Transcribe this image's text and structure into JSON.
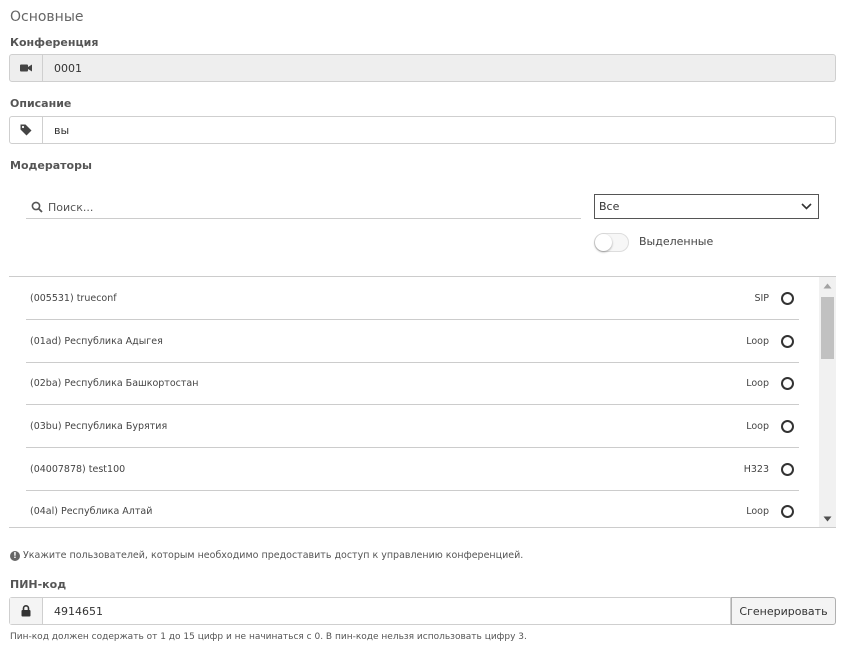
{
  "section": {
    "title": "Основные"
  },
  "conference": {
    "label": "Конференция",
    "value": "0001"
  },
  "description": {
    "label": "Описание",
    "value": "вы"
  },
  "moderators": {
    "label": "Модераторы",
    "search_placeholder": "Поиск...",
    "filter_selected": "Все",
    "toggle_label": "Выделенные",
    "toggle_on": false,
    "items": [
      {
        "name": "(005531) trueconf",
        "protocol": "SIP"
      },
      {
        "name": "(01ad) Республика Адыгея",
        "protocol": "Loop"
      },
      {
        "name": "(02ba) Республика Башкортостан",
        "protocol": "Loop"
      },
      {
        "name": "(03bu) Республика Бурятия",
        "protocol": "Loop"
      },
      {
        "name": "(04007878) test100",
        "protocol": "H323"
      },
      {
        "name": "(04al) Республика Алтай",
        "protocol": "Loop"
      }
    ],
    "hint": "Укажите пользователей, которым необходимо предоставить доступ к управлению конференцией."
  },
  "pin": {
    "label": "ПИН-код",
    "value": "4914651",
    "generate_label": "Сгенерировать",
    "note": "Пин-код должен содержать от 1 до 15 цифр и не начинаться с 0. В пин-коде нельзя использовать цифру 3."
  },
  "icons": {
    "conference": "video-camera-icon",
    "description": "tag-icon",
    "search": "search-icon",
    "select": "chevron-down-icon",
    "hint": "info-icon",
    "pin": "lock-icon"
  }
}
